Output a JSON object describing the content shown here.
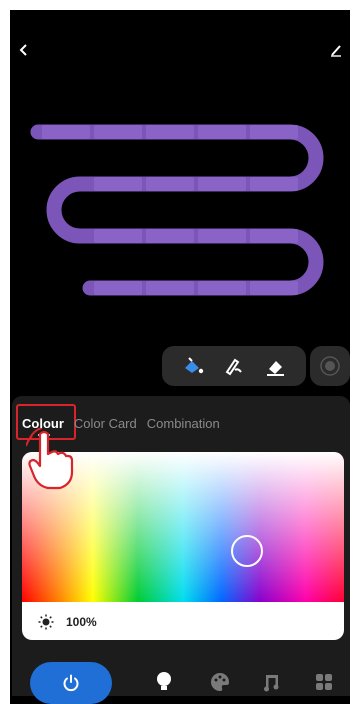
{
  "header": {
    "title": "",
    "back_icon": "chevron-left-icon",
    "edit_icon": "pencil-icon"
  },
  "canvas": {
    "strip_color": "#7b55b8",
    "segment_color": "#8a63c6",
    "rows": 4
  },
  "tools": {
    "items": [
      {
        "name": "fill-bucket-icon",
        "active": true
      },
      {
        "name": "pen-icon",
        "active": false
      },
      {
        "name": "eraser-icon",
        "active": false
      }
    ],
    "record_icon": "record-icon"
  },
  "colour_panel": {
    "tabs": [
      {
        "label": "Colour",
        "active": true
      },
      {
        "label": "Color Card",
        "active": false
      },
      {
        "label": "Combination",
        "active": false
      }
    ],
    "picker": {
      "selected_hue_fraction": 0.7,
      "selected_saturation_fraction": 0.66
    },
    "brightness": {
      "icon": "sun-icon",
      "value_text": "100%",
      "value": 100
    }
  },
  "bottom_nav": {
    "power_icon": "power-icon",
    "items": [
      {
        "name": "bulb-icon",
        "active": true
      },
      {
        "name": "palette-icon",
        "active": false
      },
      {
        "name": "music-icon",
        "active": false
      },
      {
        "name": "scenes-icon",
        "active": false
      }
    ]
  },
  "colors": {
    "accent": "#1f6fd6",
    "highlight": "#d8242a",
    "background": "#000000",
    "panel": "#1c1c1c"
  }
}
